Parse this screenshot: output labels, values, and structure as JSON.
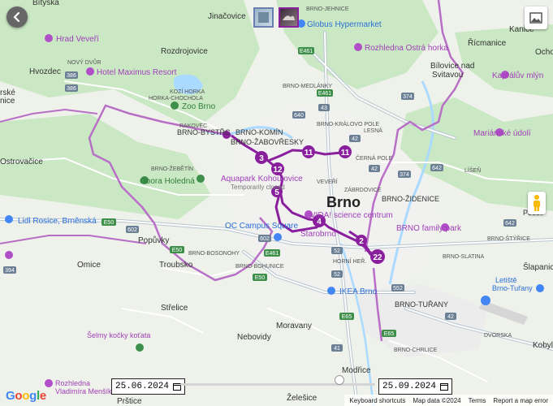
{
  "map": {
    "labels": [
      {
        "t": "Bítýška",
        "c": "dark"
      },
      {
        "t": "Jinačovice",
        "c": "dark"
      },
      {
        "t": "Hrad Veveří",
        "c": "poi"
      },
      {
        "t": "Rozdrojovice",
        "c": "dark"
      },
      {
        "t": "NOVÝ DVŮR",
        "c": "small"
      },
      {
        "t": "Hvozdec",
        "c": "dark"
      },
      {
        "t": "Hotel Maximus Resort",
        "c": "poi"
      },
      {
        "t": "KOZÍ HORKA",
        "c": "small"
      },
      {
        "t": "HORKA-CHOCHOLA",
        "c": "small"
      },
      {
        "t": "Zoo Brno",
        "c": "green"
      },
      {
        "t": "rské",
        "c": "dark"
      },
      {
        "t": "nice",
        "c": "dark"
      },
      {
        "t": "RAKOVEC",
        "c": "small"
      },
      {
        "t": "BRNO-BYSTŘC",
        "c": "area"
      },
      {
        "t": "BRNO-KOMÍN",
        "c": "area"
      },
      {
        "t": "BRNO-ŽABOVŘESKY",
        "c": "area"
      },
      {
        "t": "Ostrovačice",
        "c": "dark"
      },
      {
        "t": "BRNO-ŽEBĚTÍN",
        "c": "small"
      },
      {
        "t": "Obora Holedná",
        "c": "green"
      },
      {
        "t": "Aquapark Kohoutovice",
        "c": "poi"
      },
      {
        "t": "Temporarily closed",
        "c": "grey"
      },
      {
        "t": "Lidl Rosice, Brněnská",
        "c": "poi"
      },
      {
        "t": "OC Campus Square",
        "c": "poi"
      },
      {
        "t": "Popůvky",
        "c": "dark"
      },
      {
        "t": "Omice",
        "c": "dark"
      },
      {
        "t": "Troubsko",
        "c": "dark"
      },
      {
        "t": "BRNO-BOSONOHY",
        "c": "small"
      },
      {
        "t": "BRNO-BOHUNICE",
        "c": "small"
      },
      {
        "t": "Střelice",
        "c": "dark"
      },
      {
        "t": "Šelmy kočky koťata",
        "c": "poi"
      },
      {
        "t": "Nebovidy",
        "c": "dark"
      },
      {
        "t": "Moravany",
        "c": "dark"
      },
      {
        "t": "Rozhledna",
        "c": "poi"
      },
      {
        "t": "Vladimíra Menšíka",
        "c": "poi"
      },
      {
        "t": "Prštice",
        "c": "dark"
      },
      {
        "t": "Želešice",
        "c": "dark"
      },
      {
        "t": "Modřice",
        "c": "dark"
      },
      {
        "t": "BRNO-JEHNICE",
        "c": "small"
      },
      {
        "t": "Globus Hypermarket",
        "c": "poi"
      },
      {
        "t": "Rozhledna Ostrá horka",
        "c": "poi"
      },
      {
        "t": "BRNO-MEDLÁNKY",
        "c": "small"
      },
      {
        "t": "BRNO-KRÁLOVO POLE",
        "c": "small"
      },
      {
        "t": "LESNÁ",
        "c": "small"
      },
      {
        "t": "ČERNÁ POLE",
        "c": "small"
      },
      {
        "t": "VEVEŘÍ",
        "c": "small"
      },
      {
        "t": "ZÁBRDOVICE",
        "c": "small"
      },
      {
        "t": "Brno",
        "c": "city"
      },
      {
        "t": "VIDA! science centrum",
        "c": "poi"
      },
      {
        "t": "Starobrno",
        "c": "poi"
      },
      {
        "t": "BRNO-ŽIDENICE",
        "c": "area"
      },
      {
        "t": "BRNO family park",
        "c": "poi"
      },
      {
        "t": "HORNÍ HEŘ.",
        "c": "small"
      },
      {
        "t": "IKEA Brno",
        "c": "poi"
      },
      {
        "t": "BRNO-TUŘANY",
        "c": "area"
      },
      {
        "t": "BRNO-SLATINA",
        "c": "small"
      },
      {
        "t": "Letiště",
        "c": "poi"
      },
      {
        "t": "Brno-Tuřany",
        "c": "poi"
      },
      {
        "t": "Kanice",
        "c": "dark"
      },
      {
        "t": "Řícmanice",
        "c": "dark"
      },
      {
        "t": "Ocho",
        "c": "dark"
      },
      {
        "t": "Bílovice nad",
        "c": "dark"
      },
      {
        "t": "Svitavou",
        "c": "dark"
      },
      {
        "t": "Kaprálův mlýn",
        "c": "poi"
      },
      {
        "t": "Mariánské údolí",
        "c": "poi"
      },
      {
        "t": "LÍŠEŇ",
        "c": "small"
      },
      {
        "t": "BRNO-ŠTÝŘICE",
        "c": "small"
      },
      {
        "t": "DVORSKA",
        "c": "small"
      },
      {
        "t": "BRNO-CHRLICE",
        "c": "small"
      },
      {
        "t": "Šlapanic",
        "c": "dark"
      },
      {
        "t": "Kobyl",
        "c": "dark"
      },
      {
        "t": "Podoli",
        "c": "dark"
      },
      {
        "t": "Map data ©2024",
        "c": "grey"
      }
    ],
    "route_numbers": [
      "3",
      "12",
      "11",
      "11",
      "5",
      "4",
      "2",
      "22"
    ],
    "road_shields": [
      "386",
      "386",
      "E461",
      "E461",
      "43",
      "640",
      "42",
      "42",
      "374",
      "374",
      "642",
      "642",
      "E50",
      "E50",
      "602",
      "602",
      "394",
      "52",
      "52",
      "E461",
      "E65",
      "552",
      "E50",
      "E65",
      "41",
      "42"
    ]
  },
  "controls": {
    "back_icon": "back-arrow-icon",
    "fullscreen_icon": "fullscreen-icon",
    "pegman_icon": "pegman-icon",
    "thumb1": "photo-thumbnail",
    "thumb2": "photo-thumbnail"
  },
  "date_start": "25.06.2024",
  "date_end": "25.09.2024",
  "footer": {
    "keyboard": "Keyboard shortcuts",
    "mapdata": "Map data ©2024",
    "terms": "Terms",
    "report": "Report a map error"
  },
  "google": [
    "G",
    "o",
    "o",
    "g",
    "l",
    "e"
  ],
  "colors": {
    "route": "#8a1f9e",
    "route_light": "#b86fc6",
    "water": "#aadaff",
    "forest": "#c9e8c2",
    "road": "#ffffff"
  }
}
